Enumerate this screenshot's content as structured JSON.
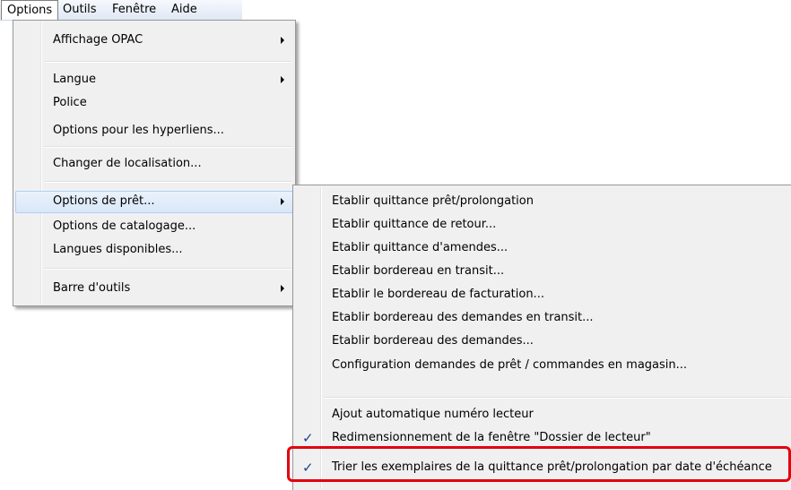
{
  "menubar": {
    "items": [
      "Options",
      "Outils",
      "Fenêtre",
      "Aide"
    ]
  },
  "options_menu": {
    "items": [
      {
        "label": "Affichage OPAC",
        "submenu": true
      },
      {
        "label": "Langue",
        "submenu": true
      },
      {
        "label": "Police",
        "submenu": false
      },
      {
        "label": "Options pour les hyperliens...",
        "submenu": false
      },
      {
        "label": "Changer de localisation...",
        "submenu": false
      },
      {
        "label": "Options de prêt...",
        "submenu": true,
        "highlighted": true
      },
      {
        "label": "Options de catalogage...",
        "submenu": false
      },
      {
        "label": "Langues disponibles...",
        "submenu": false
      },
      {
        "label": "Barre d'outils",
        "submenu": true
      }
    ]
  },
  "loan_submenu": {
    "items": [
      {
        "label": "Etablir quittance prêt/prolongation",
        "checked": false
      },
      {
        "label": "Etablir quittance de retour...",
        "checked": false
      },
      {
        "label": "Etablir quittance d'amendes...",
        "checked": false
      },
      {
        "label": "Etablir bordereau en transit...",
        "checked": false
      },
      {
        "label": "Etablir le bordereau de facturation...",
        "checked": false
      },
      {
        "label": "Etablir bordereau des demandes en transit...",
        "checked": false
      },
      {
        "label": "Etablir bordereau des demandes...",
        "checked": false
      },
      {
        "label": "Configuration demandes de prêt / commandes en magasin...",
        "checked": false
      },
      {
        "label": "Ajout automatique numéro lecteur",
        "checked": false
      },
      {
        "label": "Redimensionnement de la fenêtre \"Dossier de lecteur\"",
        "checked": true
      },
      {
        "label": "Trier les exemplaires de la quittance prêt/prolongation par date d'échéance",
        "checked": true
      }
    ],
    "check_glyph": "✓"
  },
  "colors": {
    "annotation_box": "#e3000f",
    "menu_background": "#f0f0f0",
    "highlight": "#d9e7f8"
  }
}
